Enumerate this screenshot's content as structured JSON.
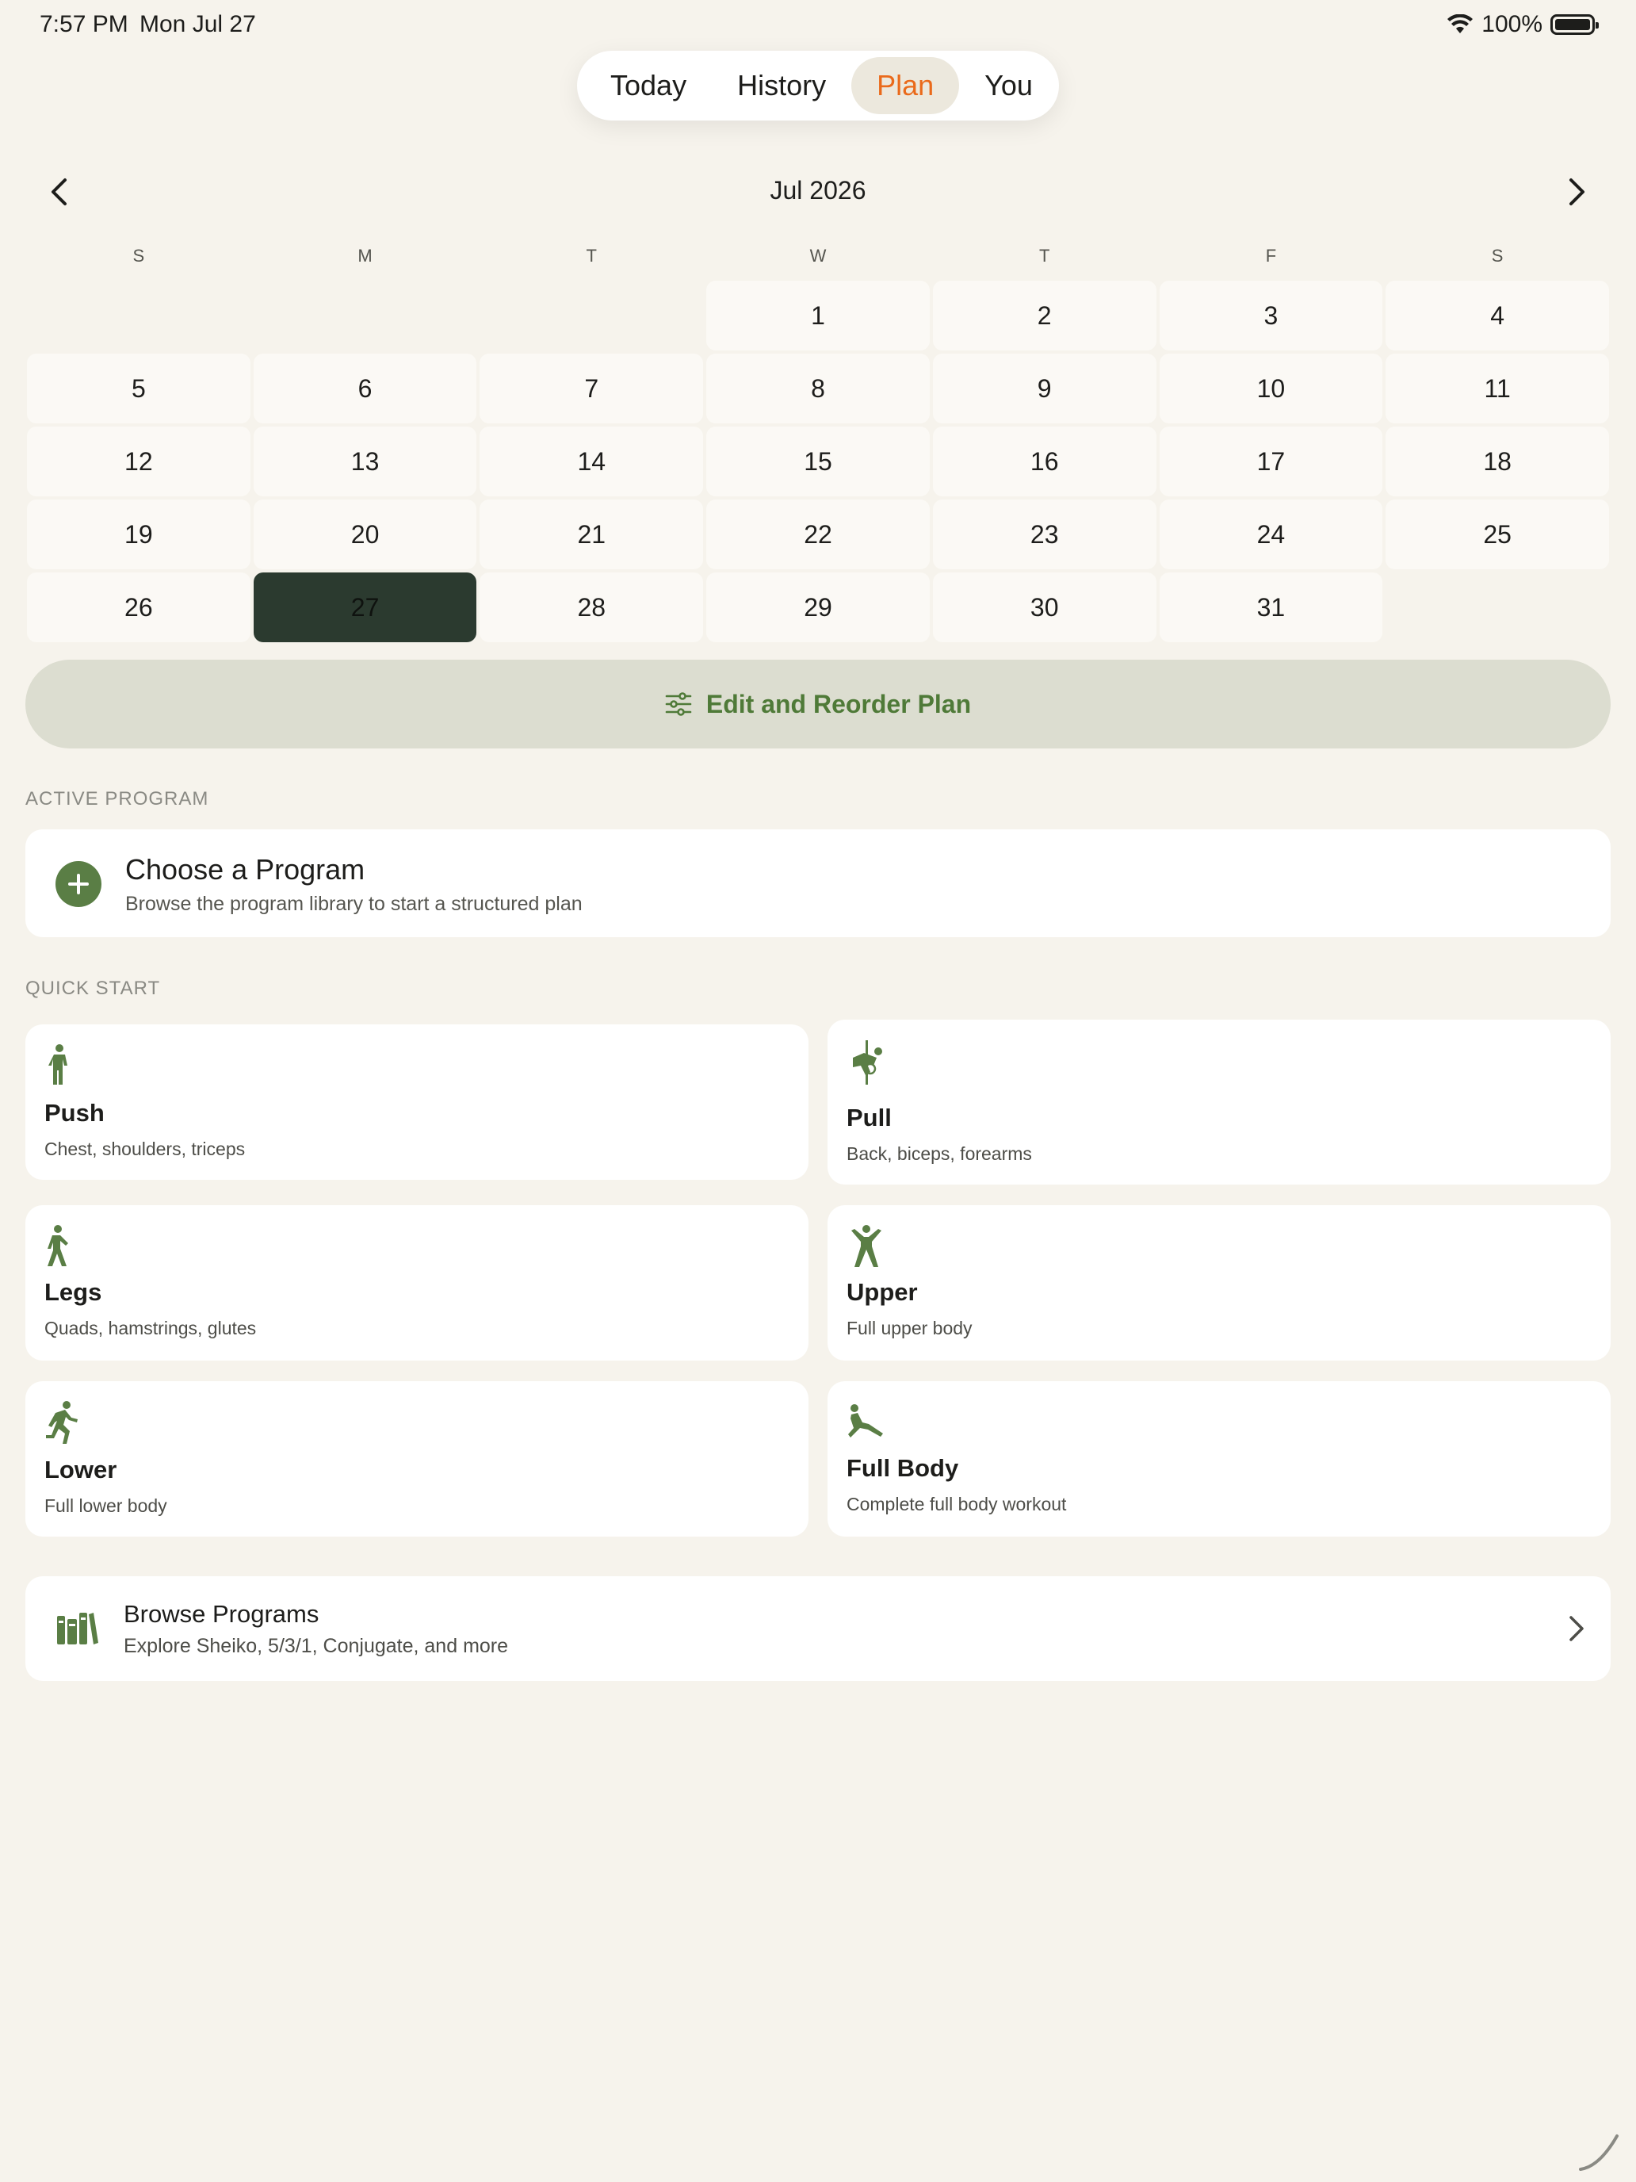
{
  "status": {
    "time": "7:57 PM",
    "date": "Mon Jul 27",
    "battery": "100%"
  },
  "tabs": [
    {
      "label": "Today",
      "active": false
    },
    {
      "label": "History",
      "active": false
    },
    {
      "label": "Plan",
      "active": true
    },
    {
      "label": "You",
      "active": false
    }
  ],
  "calendar": {
    "month": "Jul 2026",
    "weekdays": [
      "S",
      "M",
      "T",
      "W",
      "T",
      "F",
      "S"
    ],
    "first_weekday_index": 3,
    "days": 31,
    "selected_day": 27
  },
  "edit_plan_label": "Edit and Reorder Plan",
  "active_program": {
    "section_label": "ACTIVE PROGRAM",
    "title": "Choose a Program",
    "subtitle": "Browse the program library to start a structured plan"
  },
  "quick_start": {
    "section_label": "QUICK START",
    "items": [
      {
        "title": "Push",
        "subtitle": "Chest, shoulders, triceps",
        "icon": "standing-figure-icon"
      },
      {
        "title": "Pull",
        "subtitle": "Back, biceps, forearms",
        "icon": "climbing-figure-icon"
      },
      {
        "title": "Legs",
        "subtitle": "Quads, hamstrings, glutes",
        "icon": "walking-figure-icon"
      },
      {
        "title": "Upper",
        "subtitle": "Full upper body",
        "icon": "arms-up-figure-icon"
      },
      {
        "title": "Lower",
        "subtitle": "Full lower body",
        "icon": "running-figure-icon"
      },
      {
        "title": "Full Body",
        "subtitle": "Complete full body workout",
        "icon": "stretching-figure-icon"
      }
    ]
  },
  "browse": {
    "title": "Browse Programs",
    "subtitle": "Explore Sheiko, 5/3/1, Conjugate, and more"
  },
  "colors": {
    "background": "#f6f3ec",
    "accent_orange": "#ea6a1b",
    "accent_green": "#5a7e45",
    "selected_day": "#2b3a2f"
  }
}
